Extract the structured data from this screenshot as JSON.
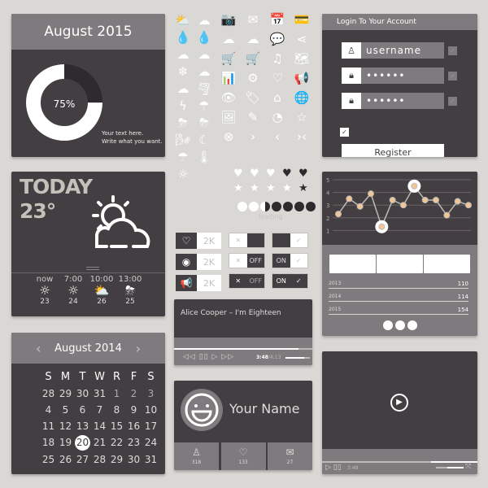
{
  "date_card": {
    "title": "August 2015",
    "percent_label": "75%",
    "percent_value": 75,
    "note_line1": "Your text here.",
    "note_line2": "Write what you want."
  },
  "login": {
    "title": "Login To Your Account",
    "username": "username",
    "password_mask": "••••••",
    "confirm_mask": "••••••",
    "check": "✓",
    "register_label": "Register"
  },
  "weather": {
    "title": "TODAY",
    "temp": "23°",
    "forecast": [
      {
        "time": "now",
        "icon": "☼",
        "temp": "23"
      },
      {
        "time": "7:00",
        "icon": "☼",
        "temp": "24"
      },
      {
        "time": "10:00",
        "icon": "⛅",
        "temp": "26"
      },
      {
        "time": "13:00",
        "icon": "⛈",
        "temp": "25"
      }
    ]
  },
  "calendar": {
    "title": "August 2014",
    "prev": "‹",
    "next": "›",
    "day_names": [
      "S",
      "M",
      "T",
      "W",
      "R",
      "F",
      "S"
    ],
    "weeks": [
      [
        "28",
        "29",
        "30",
        "31",
        "1",
        "2",
        "3"
      ],
      [
        "4",
        "5",
        "6",
        "7",
        "8",
        "9",
        "10"
      ],
      [
        "11",
        "12",
        "13",
        "14",
        "15",
        "16",
        "17"
      ],
      [
        "18",
        "19",
        "20",
        "21",
        "22",
        "23",
        "24"
      ],
      [
        "25",
        "26",
        "27",
        "28",
        "29",
        "30",
        "31"
      ]
    ],
    "selected": "20"
  },
  "icons": {
    "col1": [
      "⛅",
      "💧",
      "☁",
      "❄",
      "☁",
      "ϟ",
      "⛈",
      "🌬",
      "☂",
      "☼"
    ],
    "col2": [
      "☁",
      "💧",
      "☁",
      "☁",
      "🌪",
      "☂",
      "⛈",
      "☾",
      "🌡"
    ],
    "grid": [
      [
        "📷",
        "✉",
        "📅",
        "💳"
      ],
      [
        "☁",
        "☁",
        "💬",
        "⋖"
      ],
      [
        "🛒",
        "🛒",
        "♫",
        "🗺"
      ],
      [
        "📊",
        "⚙",
        "♡",
        "📢"
      ],
      [
        "👁",
        "🏷",
        "⌂",
        "🌐"
      ],
      [
        "🖼",
        "✎",
        "◔",
        "☆"
      ],
      [
        "⊗",
        "›",
        "‹",
        "›‹"
      ]
    ]
  },
  "ratings": {
    "hearts": 3,
    "hearts_total": 5,
    "stars": 4,
    "stars_total": 5,
    "loading_label": "loading",
    "loading_progress": 0.4
  },
  "social": [
    {
      "icon": "heart-icon",
      "glyph": "♡",
      "count": "2K"
    },
    {
      "icon": "eye-icon",
      "glyph": "◉",
      "count": "2K"
    },
    {
      "icon": "megaphone-icon",
      "glyph": "📢",
      "count": "2K"
    }
  ],
  "toggles": {
    "off_label": "OFF",
    "on_label": "ON",
    "x": "✕",
    "check": "✓"
  },
  "music": {
    "title": "Alice Cooper – I'm Eighteen",
    "controls": "◁◁ ▯▯ ▷ ▷▷",
    "elapsed": "3:48",
    "total": "/4:13",
    "progress": 0.9,
    "volume": 0.75
  },
  "profile": {
    "name": "Your Name",
    "stats": [
      {
        "icon": "user-icon",
        "glyph": "♙",
        "count": "318"
      },
      {
        "icon": "heart-icon",
        "glyph": "♡",
        "count": "133"
      },
      {
        "icon": "mail-icon",
        "glyph": "✉",
        "count": "27"
      }
    ]
  },
  "chart_data": {
    "type": "line",
    "x": [
      1,
      2,
      3,
      4,
      5,
      6,
      7,
      8,
      9,
      10,
      11,
      12,
      13
    ],
    "values": [
      2.3,
      3.5,
      2.9,
      3.9,
      1.3,
      3.4,
      3.0,
      4.5,
      3.4,
      3.4,
      2.2,
      3.3,
      3.0
    ],
    "highlighted": [
      5,
      8
    ],
    "yticks": [
      "1",
      "2",
      "3",
      "4",
      "5"
    ],
    "ylim": [
      0,
      5.2
    ],
    "grid": true,
    "title": "",
    "xlabel": "",
    "ylabel": "",
    "color": "#f2c597"
  },
  "stats_table": [
    {
      "year": "2013",
      "value": "110"
    },
    {
      "year": "2014",
      "value": "114"
    },
    {
      "year": "2015",
      "value": "154"
    }
  ],
  "video": {
    "time": "3:48",
    "progress": 0.7,
    "volume": 0.6,
    "controls": "▷ ▯▯",
    "fullscreen": "⤧"
  }
}
